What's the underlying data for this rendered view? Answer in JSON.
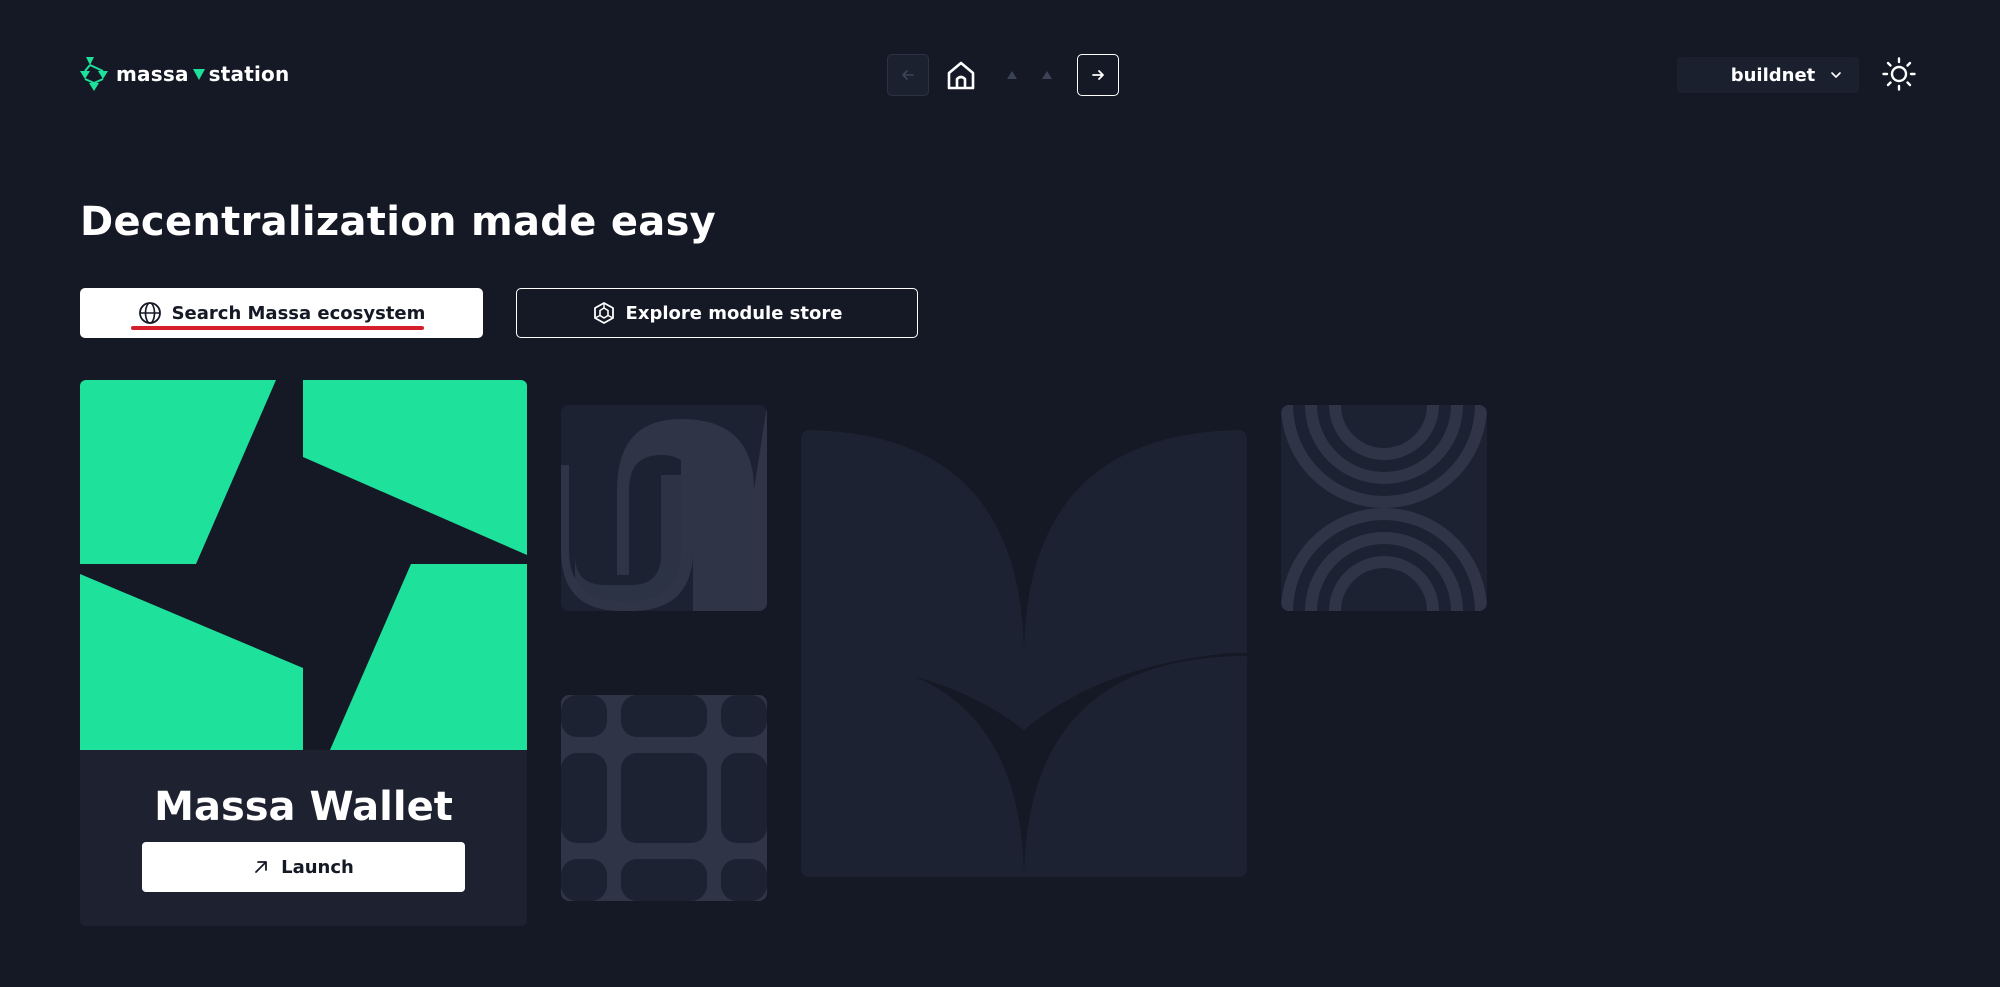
{
  "header": {
    "logo": {
      "icon": "massa-logo-icon",
      "text_left": "massa",
      "text_right": "station",
      "accent_color": "#1ee29b"
    },
    "nav": {
      "back_icon": "arrow-left-icon",
      "home_icon": "home-icon",
      "forward_icon": "arrow-right-icon"
    },
    "network": {
      "label": "buildnet",
      "icon": "chevron-down-icon"
    },
    "theme_icon": "sun-icon"
  },
  "main": {
    "headline": "Decentralization made easy",
    "search_button": {
      "label": "Search Massa ecosystem",
      "icon": "globe-icon"
    },
    "explore_button": {
      "label": "Explore module store",
      "icon": "module-cube-icon"
    },
    "wallet_card": {
      "title": "Massa Wallet",
      "launch_label": "Launch",
      "launch_icon": "arrow-up-right-icon",
      "art_color": "#1ee29b"
    }
  },
  "colors": {
    "background": "#151925",
    "tile": "#1d2232",
    "tile_pattern": "#2f3547",
    "accent": "#1ee29b",
    "highlight": "#d3202a"
  }
}
